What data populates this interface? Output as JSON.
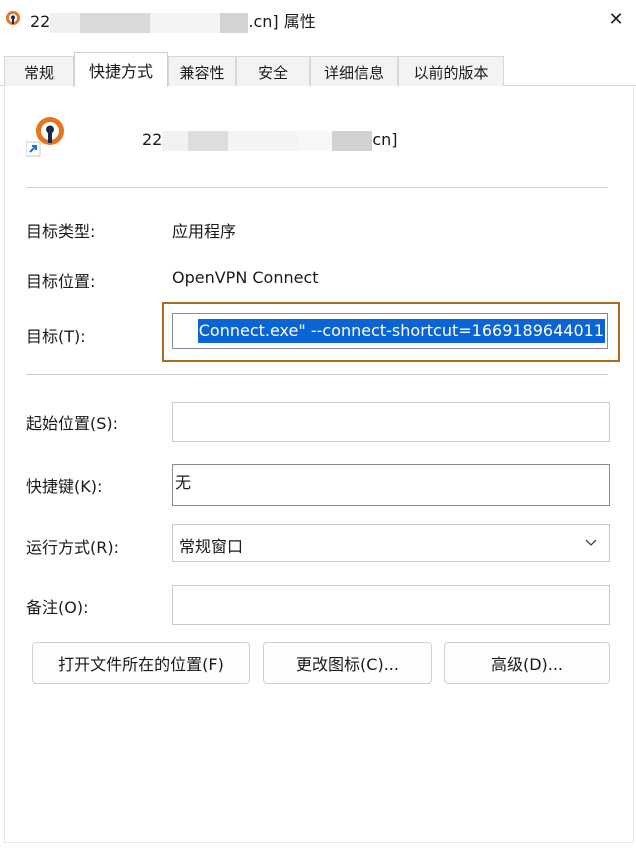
{
  "window": {
    "title_prefix": "22",
    "title_suffix": ".cn] 属性",
    "close_glyph": "✕"
  },
  "tabs": [
    {
      "label": "常规"
    },
    {
      "label": "快捷方式"
    },
    {
      "label": "兼容性"
    },
    {
      "label": "安全"
    },
    {
      "label": "详细信息"
    },
    {
      "label": "以前的版本"
    }
  ],
  "shortcut": {
    "name_prefix": "22",
    "name_suffix": "cn]",
    "icon": "openvpn-icon",
    "target_type_label": "目标类型:",
    "target_type_value": "应用程序",
    "target_location_label": "目标位置:",
    "target_location_value": "OpenVPN Connect",
    "target_label": "目标(T):",
    "target_value": "Connect.exe\" --connect-shortcut=1669189644011",
    "start_in_label": "起始位置(S):",
    "start_in_value": "",
    "hotkey_label": "快捷键(K):",
    "hotkey_value": "无",
    "run_label": "运行方式(R):",
    "run_value": "常规窗口",
    "comment_label": "备注(O):",
    "comment_value": ""
  },
  "buttons": {
    "open_location": "打开文件所在的位置(F)",
    "change_icon": "更改图标(C)...",
    "advanced": "高级(D)..."
  },
  "colors": {
    "selection": "#0a64d6",
    "highlight_frame": "#b06a1e",
    "openvpn_orange": "#e8741e",
    "openvpn_navy": "#1b2a4a"
  }
}
